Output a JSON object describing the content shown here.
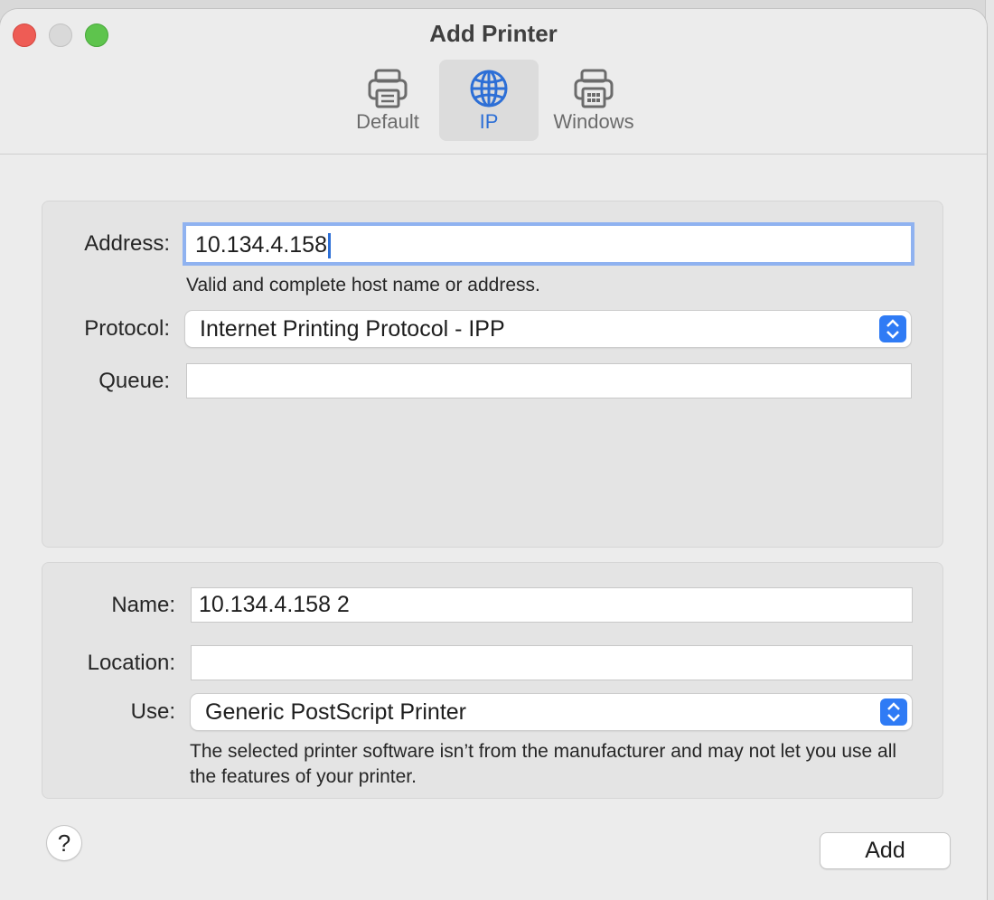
{
  "window": {
    "title": "Add Printer"
  },
  "toolbar": {
    "tabs": [
      {
        "label": "Default",
        "icon": "printer-icon"
      },
      {
        "label": "IP",
        "icon": "globe-icon"
      },
      {
        "label": "Windows",
        "icon": "windows-printer-icon"
      }
    ],
    "selected": "IP"
  },
  "ip_panel": {
    "address_label": "Address:",
    "address_value": "10.134.4.158",
    "address_hint": "Valid and complete host name or address.",
    "protocol_label": "Protocol:",
    "protocol_value": "Internet Printing Protocol - IPP",
    "queue_label": "Queue:",
    "queue_value": ""
  },
  "printer_panel": {
    "name_label": "Name:",
    "name_value": "10.134.4.158 2",
    "location_label": "Location:",
    "location_value": "",
    "use_label": "Use:",
    "use_value": "Generic PostScript Printer",
    "use_note": "The selected printer software isn’t from the manufacturer and may not let you use all the features of your printer."
  },
  "footer": {
    "help_label": "?",
    "add_label": "Add"
  },
  "colors": {
    "accent": "#2d6fd6",
    "close": "#ee5c55",
    "minimize": "#d9d9d9",
    "maximize": "#5ec44d"
  }
}
